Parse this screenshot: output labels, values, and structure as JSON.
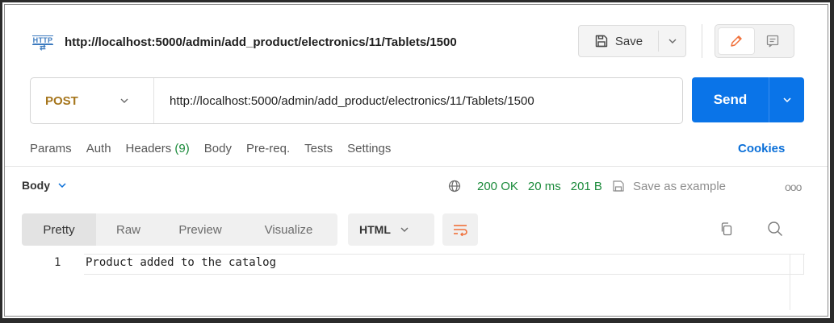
{
  "colors": {
    "accent": "#0a74e8",
    "method_post": "#a6761d",
    "status_green": "#1a8a3a",
    "link_blue": "#0a6fd8",
    "http_icon": "#3d7bbf",
    "edit_icon": "#f0703a"
  },
  "header": {
    "http_icon_label": "HTTP",
    "title": "http://localhost:5000/admin/add_product/electronics/11/Tablets/1500",
    "save_label": "Save",
    "icons": [
      "save-icon",
      "chevron-down-icon",
      "edit-pencil-icon",
      "comments-icon"
    ]
  },
  "request": {
    "method": "POST",
    "url": "http://localhost:5000/admin/add_product/electronics/11/Tablets/1500",
    "send_label": "Send"
  },
  "request_tabs": {
    "params": "Params",
    "auth": "Auth",
    "headers": "Headers",
    "headers_count": "(9)",
    "body": "Body",
    "prereq": "Pre-req.",
    "tests": "Tests",
    "settings": "Settings",
    "cookies": "Cookies"
  },
  "response": {
    "body_label": "Body",
    "status": "200 OK",
    "time": "20 ms",
    "size": "201 B",
    "save_example": "Save as example",
    "more": "ooo"
  },
  "view_tabs": {
    "pretty": "Pretty",
    "raw": "Raw",
    "preview": "Preview",
    "visualize": "Visualize",
    "format": "HTML"
  },
  "code": {
    "line_number": "1",
    "text": "Product added to the catalog"
  }
}
